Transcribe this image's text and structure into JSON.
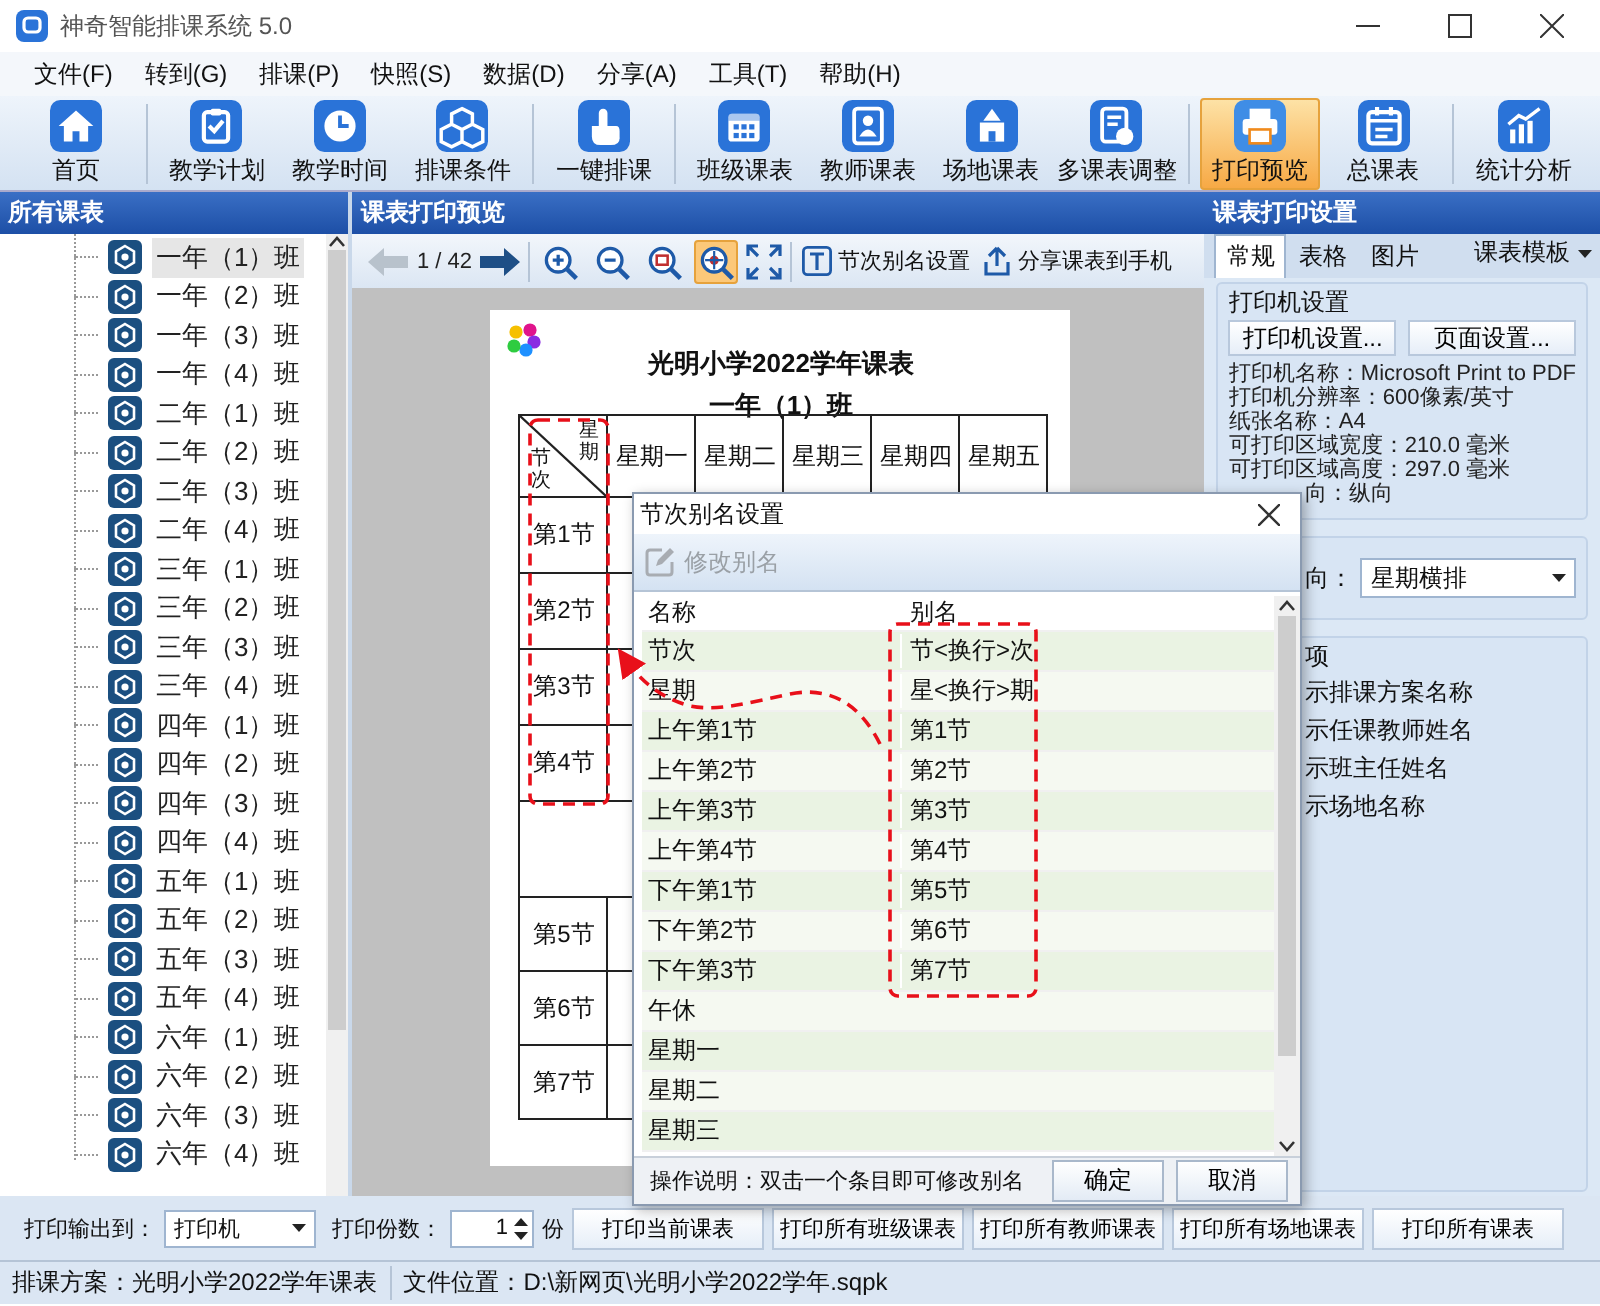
{
  "window": {
    "title": "神奇智能排课系统 5.0"
  },
  "menu": [
    "文件(F)",
    "转到(G)",
    "排课(P)",
    "快照(S)",
    "数据(D)",
    "分享(A)",
    "工具(T)",
    "帮助(H)"
  ],
  "toolbar": {
    "groups": [
      [
        {
          "label": "首页",
          "selected": false
        }
      ],
      [
        {
          "label": "教学计划",
          "selected": false
        },
        {
          "label": "教学时间",
          "selected": false
        },
        {
          "label": "排课条件",
          "selected": false
        }
      ],
      [
        {
          "label": "一键排课",
          "selected": false
        }
      ],
      [
        {
          "label": "班级课表",
          "selected": false
        },
        {
          "label": "教师课表",
          "selected": false
        },
        {
          "label": "场地课表",
          "selected": false
        },
        {
          "label": "多课表调整",
          "selected": false
        }
      ],
      [
        {
          "label": "打印预览",
          "selected": true
        },
        {
          "label": "总课表",
          "selected": false
        }
      ],
      [
        {
          "label": "统计分析",
          "selected": false
        }
      ]
    ]
  },
  "left_panel": {
    "title": "所有课表",
    "items": [
      {
        "label": "一年（1）班",
        "selected": true
      },
      {
        "label": "一年（2）班",
        "selected": false
      },
      {
        "label": "一年（3）班",
        "selected": false
      },
      {
        "label": "一年（4）班",
        "selected": false
      },
      {
        "label": "二年（1）班",
        "selected": false
      },
      {
        "label": "二年（2）班",
        "selected": false
      },
      {
        "label": "二年（3）班",
        "selected": false
      },
      {
        "label": "二年（4）班",
        "selected": false
      },
      {
        "label": "三年（1）班",
        "selected": false
      },
      {
        "label": "三年（2）班",
        "selected": false
      },
      {
        "label": "三年（3）班",
        "selected": false
      },
      {
        "label": "三年（4）班",
        "selected": false
      },
      {
        "label": "四年（1）班",
        "selected": false
      },
      {
        "label": "四年（2）班",
        "selected": false
      },
      {
        "label": "四年（3）班",
        "selected": false
      },
      {
        "label": "四年（4）班",
        "selected": false
      },
      {
        "label": "五年（1）班",
        "selected": false
      },
      {
        "label": "五年（2）班",
        "selected": false
      },
      {
        "label": "五年（3）班",
        "selected": false
      },
      {
        "label": "五年（4）班",
        "selected": false
      },
      {
        "label": "六年（1）班",
        "selected": false
      },
      {
        "label": "六年（2）班",
        "selected": false
      },
      {
        "label": "六年（3）班",
        "selected": false
      },
      {
        "label": "六年（4）班",
        "selected": false
      }
    ]
  },
  "preview": {
    "title": "课表打印预览",
    "page": "1 / 42",
    "prev_disabled": true,
    "zoom_tools": [
      {
        "selected": false
      },
      {
        "selected": false
      },
      {
        "selected": false
      },
      {
        "selected": true
      }
    ],
    "alias_button": "节次别名设置",
    "share_button": "分享课表到手机"
  },
  "paper": {
    "title": "光明小学2022学年课表",
    "subtitle": "一年（1）班",
    "corner_top": "星期",
    "corner_bottom": "节次",
    "days": [
      "星期一",
      "星期二",
      "星期三",
      "星期四",
      "星期五"
    ],
    "morning": [
      "第1节",
      "第2节",
      "第3节",
      "第4节"
    ],
    "afternoon": [
      "第5节",
      "第6节",
      "第7节"
    ]
  },
  "right_panel": {
    "title": "课表打印设置",
    "tabs": [
      {
        "label": "常规",
        "selected": true
      },
      {
        "label": "表格",
        "selected": false
      },
      {
        "label": "图片",
        "selected": false
      }
    ],
    "template_menu": "课表模板",
    "printer_group": {
      "title": "打印机设置",
      "buttons": [
        "打印机设置...",
        "页面设置..."
      ],
      "lines": [
        {
          "text": "打印机名称：Microsoft Print to PDF",
          "kind": "full"
        },
        {
          "text": "打印机分辨率：600像素/英寸",
          "kind": "full"
        },
        {
          "text": "纸张名称：A4",
          "kind": "full"
        },
        {
          "text": "可打印区域宽度：210.0 毫米",
          "kind": "full"
        },
        {
          "text": "可打印区域高度：297.0 毫米",
          "kind": "full"
        },
        {
          "text": "向：纵向",
          "kind": "partial"
        }
      ]
    },
    "layout_group": {
      "label": "向：",
      "value": "星期横排"
    },
    "options_group": {
      "title": "项",
      "options": [
        "示排课方案名称",
        "示任课教师姓名",
        "示班主任姓名",
        "示场地名称"
      ]
    }
  },
  "dialog": {
    "title": "节次别名设置",
    "edit_button": {
      "label": "修改别名",
      "disabled": true
    },
    "columns": [
      "名称",
      "别名"
    ],
    "rows": [
      {
        "name": "节次",
        "alias": "节<换行>次"
      },
      {
        "name": "星期",
        "alias": "星<换行>期"
      },
      {
        "name": "上午第1节",
        "alias": "第1节"
      },
      {
        "name": "上午第2节",
        "alias": "第2节"
      },
      {
        "name": "上午第3节",
        "alias": "第3节"
      },
      {
        "name": "上午第4节",
        "alias": "第4节"
      },
      {
        "name": "下午第1节",
        "alias": "第5节"
      },
      {
        "name": "下午第2节",
        "alias": "第6节"
      },
      {
        "name": "下午第3节",
        "alias": "第7节"
      },
      {
        "name": "午休"
      },
      {
        "name": "星期一"
      },
      {
        "name": "星期二"
      },
      {
        "name": "星期三"
      }
    ],
    "hint": "操作说明：双击一个条目即可修改别名",
    "buttons": [
      "确定",
      "取消"
    ]
  },
  "output_bar": {
    "output_label": "打印输出到：",
    "output_value": "打印机",
    "copies_label": "打印份数：",
    "copies_value": "1",
    "copies_unit": "份",
    "buttons": [
      "打印当前课表",
      "打印所有班级课表",
      "打印所有教师课表",
      "打印所有场地课表",
      "打印所有课表"
    ]
  },
  "status_bar": [
    "排课方案：光明小学2022学年课表",
    "文件位置：D:\\新网页\\光明小学2022学年.sqpk"
  ]
}
